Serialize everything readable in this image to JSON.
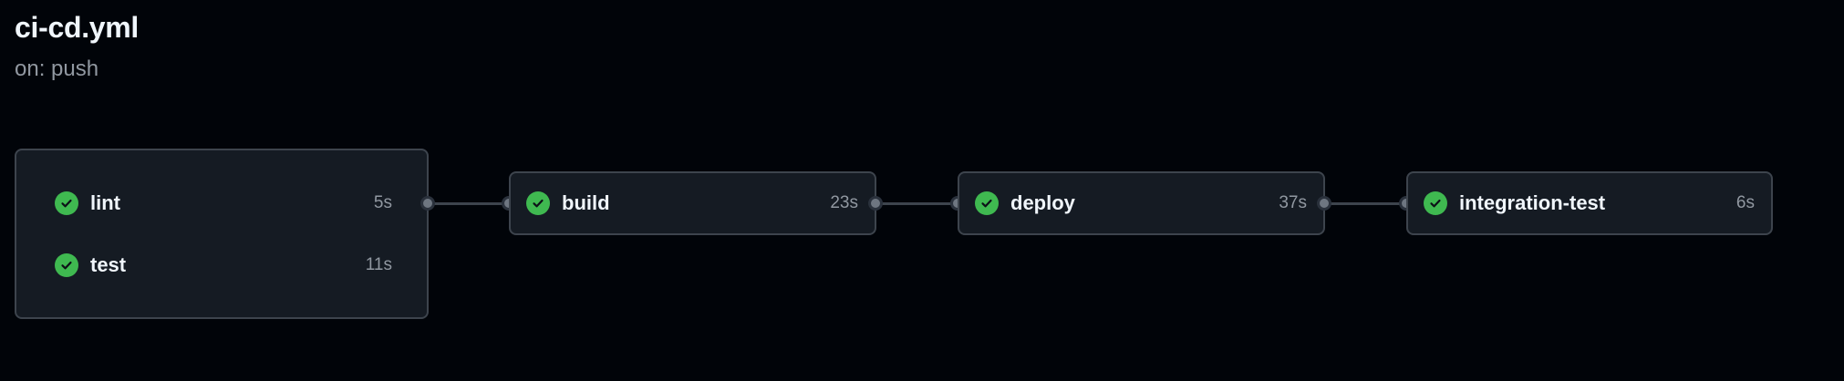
{
  "workflow": {
    "title": "ci-cd.yml",
    "trigger": "on: push"
  },
  "jobs": {
    "lint": {
      "name": "lint",
      "duration": "5s",
      "status": "success"
    },
    "test": {
      "name": "test",
      "duration": "11s",
      "status": "success"
    },
    "build": {
      "name": "build",
      "duration": "23s",
      "status": "success"
    },
    "deploy": {
      "name": "deploy",
      "duration": "37s",
      "status": "success"
    },
    "integration_test": {
      "name": "integration-test",
      "duration": "6s",
      "status": "success"
    }
  },
  "icons": {
    "status": "check-circle-icon",
    "connector": "connector-dot-icon"
  },
  "colors": {
    "background": "#010409",
    "card": "#151b23",
    "border": "#3d444d",
    "success": "#3fb950",
    "text": "#f0f6fc",
    "muted": "#9198a1"
  }
}
